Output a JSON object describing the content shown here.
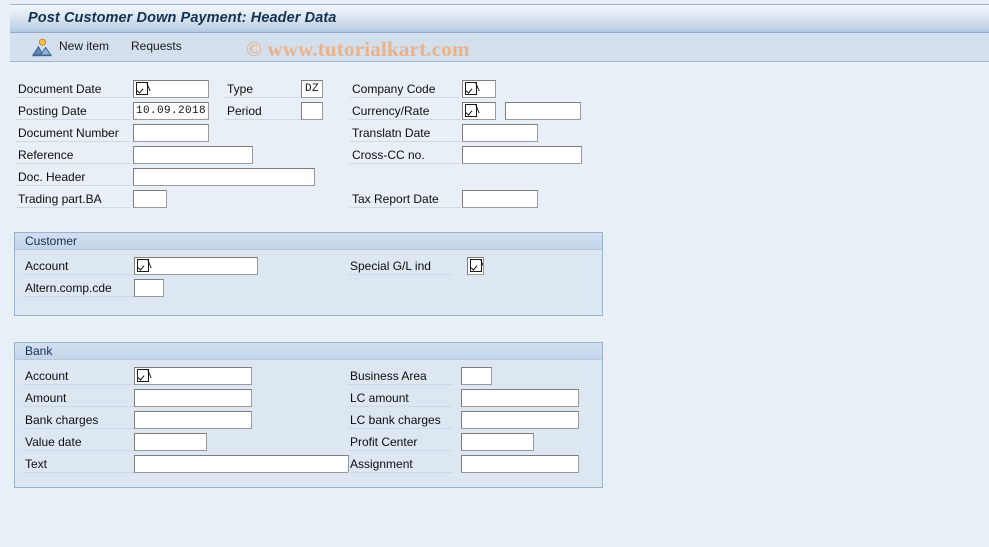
{
  "window": {
    "title": "Post Customer Down Payment: Header Data"
  },
  "toolbar": {
    "new_item_label": "New item",
    "requests_label": "Requests",
    "icon": "new-item-picture-icon"
  },
  "watermark": {
    "text": "© www.tutorialkart.com",
    "color": "#eab288"
  },
  "header_section": {
    "left_fields": [
      {
        "label": "Document Date",
        "value": "",
        "has_checkbox": true
      },
      {
        "label": "Posting Date",
        "value": "10.09.2018",
        "has_checkbox": false
      },
      {
        "label": "Document Number",
        "value": "",
        "has_checkbox": false
      },
      {
        "label": "Reference",
        "value": "",
        "has_checkbox": false
      },
      {
        "label": "Doc. Header",
        "value": "",
        "has_checkbox": false
      },
      {
        "label": "Trading part.BA",
        "value": "",
        "has_checkbox": false
      }
    ],
    "middle_fields": [
      {
        "label": "Type",
        "value": "DZ"
      },
      {
        "label": "Period",
        "value": ""
      }
    ],
    "right_fields": [
      {
        "label": "Company Code",
        "value": "",
        "has_checkbox": true,
        "second_value": null
      },
      {
        "label": "Currency/Rate",
        "value": "",
        "has_checkbox": true,
        "second_value": ""
      },
      {
        "label": "Translatn Date",
        "value": "",
        "has_checkbox": false,
        "second_value": null
      },
      {
        "label": "Cross-CC no.",
        "value": "",
        "has_checkbox": false,
        "second_value": null
      },
      {
        "label": "Tax Report Date",
        "value": "",
        "has_checkbox": false,
        "second_value": null
      }
    ]
  },
  "customer_section": {
    "title": "Customer",
    "fields": [
      {
        "label": "Account",
        "value": "",
        "has_checkbox": true
      },
      {
        "label": "Altern.comp.cde",
        "value": "",
        "has_checkbox": false
      },
      {
        "label": "Special G/L ind",
        "value": "",
        "has_checkbox": true
      }
    ]
  },
  "bank_section": {
    "title": "Bank",
    "left_fields": [
      {
        "label": "Account",
        "value": "",
        "has_checkbox": true
      },
      {
        "label": "Amount",
        "value": "",
        "has_checkbox": false
      },
      {
        "label": "Bank charges",
        "value": "",
        "has_checkbox": false
      },
      {
        "label": "Value date",
        "value": "",
        "has_checkbox": false
      },
      {
        "label": "Text",
        "value": "",
        "has_checkbox": false
      }
    ],
    "right_fields": [
      {
        "label": "Business Area",
        "value": ""
      },
      {
        "label": "LC amount",
        "value": ""
      },
      {
        "label": "LC bank charges",
        "value": ""
      },
      {
        "label": "Profit Center",
        "value": ""
      },
      {
        "label": "Assignment",
        "value": ""
      }
    ]
  }
}
